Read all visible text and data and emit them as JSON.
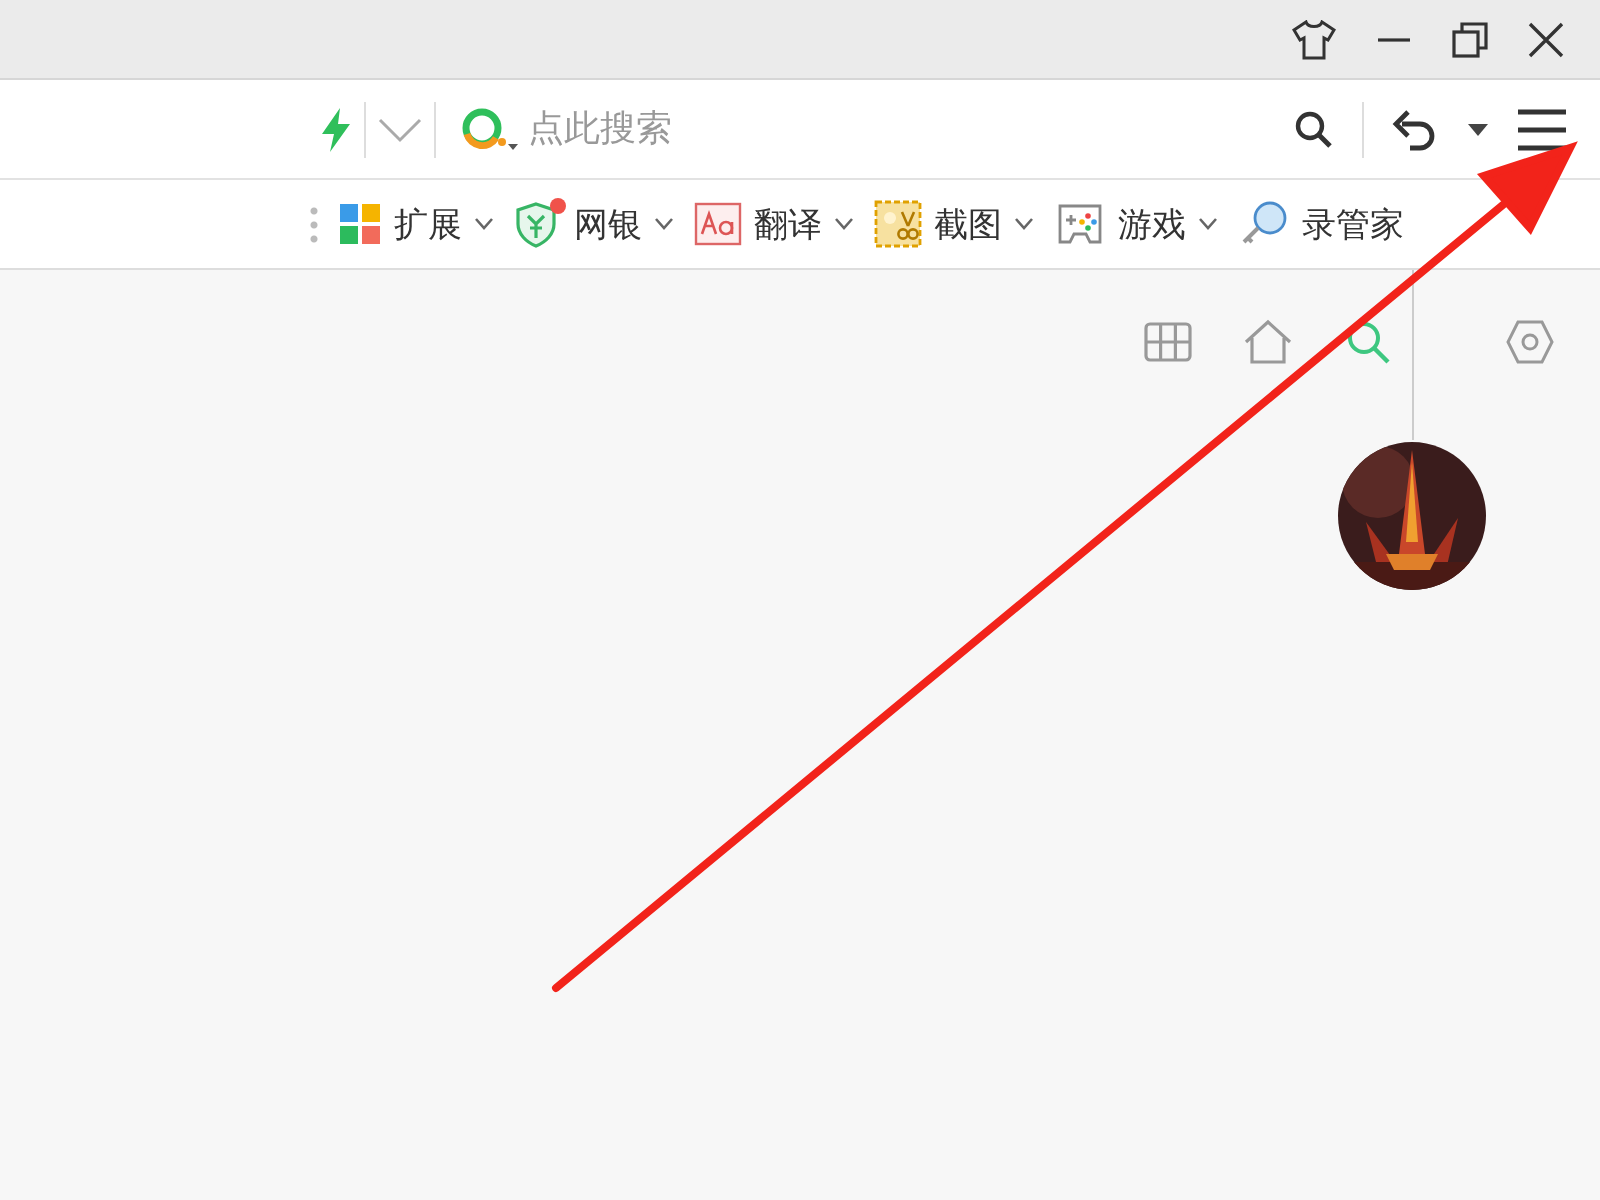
{
  "address_bar": {
    "placeholder": "点此搜索"
  },
  "toolbar": {
    "items": [
      {
        "kind": "menu",
        "label": "扩展",
        "badge": false
      },
      {
        "kind": "menu",
        "label": "网银",
        "badge": true
      },
      {
        "kind": "menu",
        "label": "翻译",
        "badge": false
      },
      {
        "kind": "menu",
        "label": "截图",
        "badge": false
      },
      {
        "kind": "menu",
        "label": "游戏",
        "badge": false
      },
      {
        "kind": "link",
        "label": "录管家",
        "badge": false
      }
    ]
  },
  "start_page": {
    "nav": [
      {
        "selected": false
      },
      {
        "selected": false
      },
      {
        "selected": true
      }
    ]
  }
}
